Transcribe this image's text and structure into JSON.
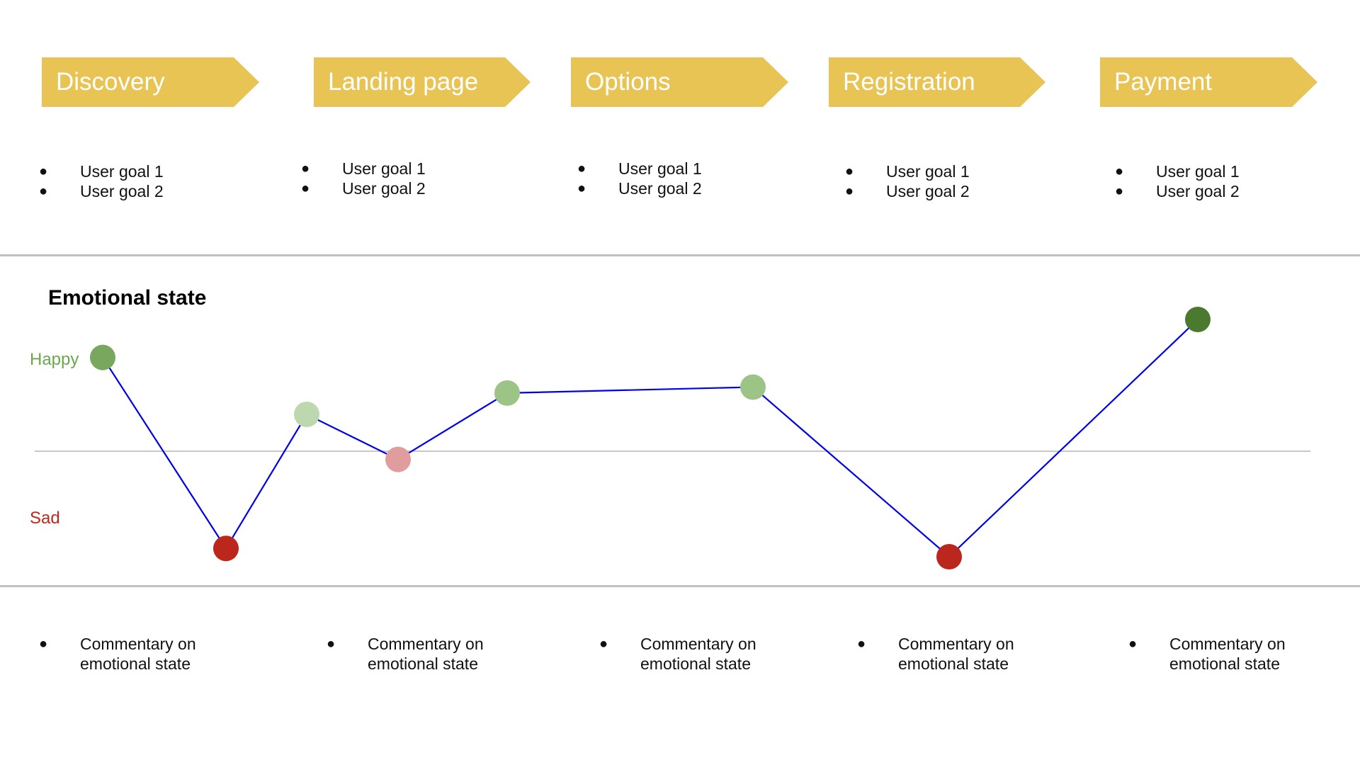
{
  "stages": [
    {
      "label": "Discovery",
      "goals": [
        "User goal 1",
        "User goal 2"
      ],
      "commentary": "Commentary on emotional state"
    },
    {
      "label": "Landing page",
      "goals": [
        "User goal 1",
        "User goal 2"
      ],
      "commentary": "Commentary on emotional state"
    },
    {
      "label": "Options",
      "goals": [
        "User goal 1",
        "User goal 2"
      ],
      "commentary": "Commentary on emotional state"
    },
    {
      "label": "Registration",
      "goals": [
        "User goal 1",
        "User goal 2"
      ],
      "commentary": "Commentary on emotional state"
    },
    {
      "label": "Payment",
      "goals": [
        "User goal 1",
        "User goal 2"
      ],
      "commentary": "Commentary on emotional state"
    }
  ],
  "bullet_glyph": "●",
  "emotion": {
    "title": "Emotional state",
    "happy_label": "Happy",
    "sad_label": "Sad",
    "colors": {
      "chevron": "#e8c454",
      "line": "#0000ee",
      "baseline": "#c8c8c8",
      "happy_text": "#6aa84f",
      "sad_text": "#c0281c"
    }
  },
  "chart_data": {
    "type": "line",
    "title": "Emotional state",
    "ylabel_top": "Happy",
    "ylabel_bottom": "Sad",
    "ylim": [
      -1,
      1
    ],
    "baseline": 0,
    "points": [
      {
        "step": 1,
        "value": 0.68,
        "color": "#79a75d"
      },
      {
        "step": 2,
        "value": -0.93,
        "color": "#bb271d"
      },
      {
        "step": 3,
        "value": 0.2,
        "color": "#bdd8ae"
      },
      {
        "step": 4,
        "value": -0.18,
        "color": "#df9d9d"
      },
      {
        "step": 5,
        "value": 0.38,
        "color": "#9dc487"
      },
      {
        "step": 6,
        "value": 0.43,
        "color": "#9dc487"
      },
      {
        "step": 7,
        "value": -1.0,
        "color": "#bb271d"
      },
      {
        "step": 8,
        "value": 1.0,
        "color": "#4a7a2f"
      }
    ]
  }
}
